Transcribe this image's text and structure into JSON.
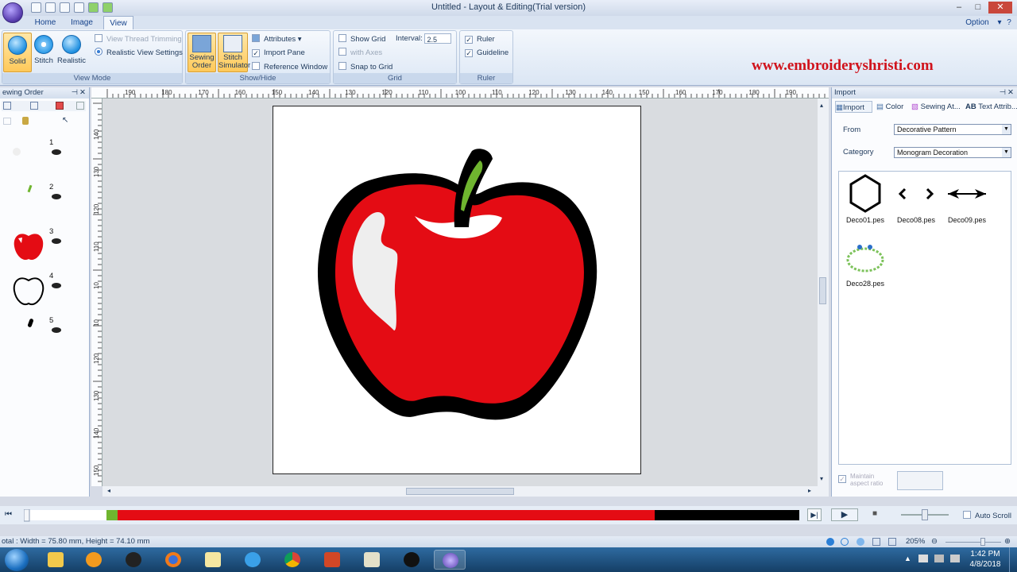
{
  "window": {
    "title": "Untitled - Layout & Editing(Trial version)",
    "option_label": "Option"
  },
  "tabs": [
    "Home",
    "Image",
    "View"
  ],
  "ribbon": {
    "view_mode": {
      "label": "View Mode",
      "buttons": [
        "Solid",
        "Stitch",
        "Realistic"
      ],
      "options": [
        "View Thread Trimming",
        "Realistic View Settings"
      ]
    },
    "show_hide": {
      "label": "Show/Hide",
      "sewing_order": [
        "Sewing",
        "Order"
      ],
      "stitch_simulator": [
        "Stitch",
        "Simulator"
      ],
      "attributes": "Attributes",
      "import_pane": "Import Pane",
      "reference_window": "Reference Window"
    },
    "grid": {
      "label": "Grid",
      "show_grid": "Show Grid",
      "interval_label": "Interval:",
      "interval_value": "2.5",
      "with_axes": "with Axes",
      "snap_to_grid": "Snap to Grid"
    },
    "ruler": {
      "label": "Ruler",
      "ruler": "Ruler",
      "guideline": "Guideline"
    }
  },
  "watermark": "www.embroideryshristi.com",
  "sewing_order": {
    "title": "ewing Order",
    "items": [
      "1",
      "2",
      "3",
      "4",
      "5"
    ]
  },
  "ruler_top_labels": [
    "190",
    "180",
    "170",
    "160",
    "150",
    "140",
    "130",
    "120",
    "110",
    "100",
    "110",
    "120",
    "130",
    "140",
    "150",
    "160",
    "170",
    "180",
    "190"
  ],
  "ruler_left_labels": [
    "140",
    "130",
    "120",
    "110",
    "10",
    "10",
    "120",
    "130",
    "140",
    "150"
  ],
  "import_panel": {
    "title": "Import",
    "tabs": [
      "Import",
      "Color",
      "Sewing At...",
      "Text Attrib..."
    ],
    "from_label": "From",
    "from_value": "Decorative Pattern",
    "category_label": "Category",
    "category_value": "Monogram Decoration",
    "patterns": [
      "Deco01.pes",
      "Deco08.pes",
      "Deco09.pes",
      "Deco28.pes"
    ],
    "maintain_aspect": [
      "Maintain",
      "aspect ratio"
    ]
  },
  "playback": {
    "auto_scroll": "Auto Scroll"
  },
  "status": {
    "size_text": "otal : Width = 75.80 mm, Height = 74.10 mm",
    "zoom": "205%"
  },
  "taskbar": {
    "time": "1:42 PM",
    "date": "4/8/2018"
  },
  "colors": {
    "apple_red": "#e40c14",
    "leaf_green": "#6fb52f",
    "outline": "#000000",
    "highlight": "#eeeeee",
    "brand_watermark": "#d0121b"
  }
}
